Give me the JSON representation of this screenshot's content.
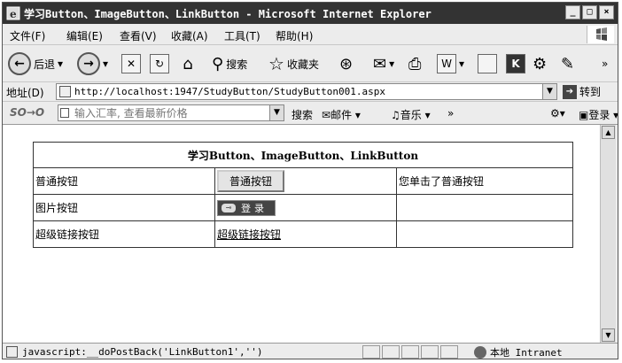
{
  "window": {
    "title": "学习Button、ImageButton、LinkButton - Microsoft Internet Explorer",
    "min_label": "_",
    "max_label": "□",
    "close_label": "×"
  },
  "menu": [
    {
      "label": "文件(F)"
    },
    {
      "label": "编辑(E)"
    },
    {
      "label": "查看(V)"
    },
    {
      "label": "收藏(A)"
    },
    {
      "label": "工具(T)"
    },
    {
      "label": "帮助(H)"
    }
  ],
  "toolbar": {
    "back_label": "后退",
    "search_label": "搜索",
    "favorites_label": "收藏夹"
  },
  "address": {
    "label": "地址(D)",
    "url": "http://localhost:1947/StudyButton/StudyButton001.aspx",
    "go_label": "转到"
  },
  "searchbar": {
    "logo": "SO→O",
    "placeholder": "输入汇率, 查看最新价格",
    "search_label": "搜索",
    "mail_label": "邮件",
    "music_label": "音乐",
    "more_label": "»",
    "login_label": "登录"
  },
  "page": {
    "table_header": "学习Button、ImageButton、LinkButton",
    "rows": [
      {
        "label": "普通按钮",
        "control": "普通按钮",
        "result": "您单击了普通按钮"
      },
      {
        "label": "图片按钮",
        "control": "登录",
        "result": ""
      },
      {
        "label": "超级链接按钮",
        "control": "超级链接按钮",
        "result": ""
      }
    ]
  },
  "status": {
    "text": "javascript:__doPostBack('LinkButton1','')",
    "zone": "本地 Intranet"
  }
}
